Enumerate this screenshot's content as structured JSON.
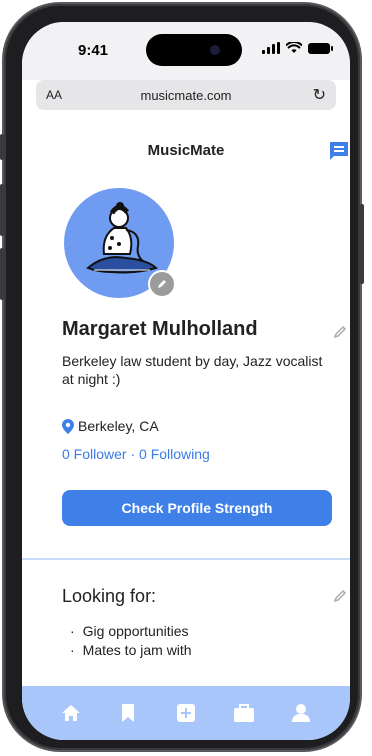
{
  "status_bar": {
    "time": "9:41"
  },
  "browser": {
    "text_size_label": "AA",
    "url": "musicmate.com",
    "reload_glyph": "↻"
  },
  "app": {
    "title": "MusicMate",
    "accent": "#3f7fe8",
    "tabbar_bg": "#a9c6fa"
  },
  "profile": {
    "name": "Margaret Mulholland",
    "bio": "Berkeley law student by day, Jazz vocalist at night :)",
    "location": "Berkeley, CA",
    "follow_stats": "0 Follower · 0 Following",
    "cta_label": "Check Profile Strength"
  },
  "looking_for": {
    "title": "Looking for:",
    "items": [
      "Gig opportunities",
      "Mates to jam with"
    ]
  },
  "tabs": [
    {
      "icon": "home-icon"
    },
    {
      "icon": "bookmark-icon"
    },
    {
      "icon": "add-icon"
    },
    {
      "icon": "briefcase-icon"
    },
    {
      "icon": "profile-icon"
    }
  ]
}
